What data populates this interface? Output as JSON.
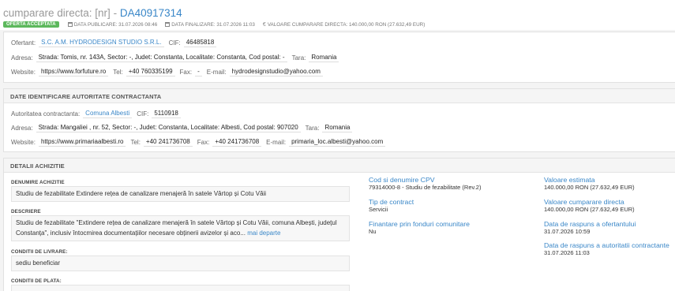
{
  "header": {
    "title_prefix": "cumparare directa: [nr]",
    "title_sep": "-",
    "title_code": "DA40917314",
    "badge": "OFERTA ACCEPTATA",
    "date_publicare": "DATA PUBLICARE: 31.07.2026 08:46",
    "date_finalizare": "DATA FINALIZARE: 31.07.2026 11:03",
    "valoare": "VALOARE CUMPARARE DIRECTA: 140.000,00 RON (27.632,49 EUR)"
  },
  "ofertant": {
    "label": "Ofertant:",
    "name": "S.C. A.M. HYDRODESIGN STUDIO S.R.L.",
    "cif_label": "CIF:",
    "cif": "46485818",
    "adresa_label": "Adresa:",
    "adresa": "Strada: Tomis, nr. 143A, Sector: -, Judet: Constanta, Localitate: Constanta, Cod postal: -",
    "tara_label": "Tara:",
    "tara": "Romania",
    "website_label": "Website:",
    "website": "https://www.forfuture.ro",
    "tel_label": "Tel:",
    "tel": "+40 760335199",
    "fax_label": "Fax:",
    "fax": "-",
    "email_label": "E-mail:",
    "email": "hydrodesignstudio@yahoo.com"
  },
  "autoritate": {
    "heading": "DATE IDENTIFICARE AUTORITATE CONTRACTANTA",
    "label": "Autoritatea contractanta:",
    "name": "Comuna Albesti",
    "cif_label": "CIF:",
    "cif": "5110918",
    "adresa_label": "Adresa:",
    "adresa": "Strada: Mangaliei , nr. 52, Sector: -, Judet: Constanta, Localitate: Albesti, Cod postal: 907020",
    "tara_label": "Tara:",
    "tara": "Romania",
    "website_label": "Website:",
    "website": "https://www.primariaalbesti.ro",
    "tel_label": "Tel:",
    "tel": "+40 241736708",
    "fax_label": "Fax:",
    "fax": "+40 241736708",
    "email_label": "E-mail:",
    "email": "primaria_loc.albesti@yahoo.com"
  },
  "detalii": {
    "heading": "DETALII ACHIZITIE",
    "denumire_label": "DENUMIRE ACHIZITIE",
    "denumire": "Studiu de fezabilitate Extindere rețea de canalizare menajeră în satele Vârtop și Cotu Văii",
    "descriere_label": "DESCRIERE",
    "descriere": "Studiu de fezabilitate \"Extindere rețea de canalizare menajeră în satele Vârtop și Cotu Văii, comuna Albești, județul Constanța\", inclusiv întocmirea documentațiilor necesare obținerii avizelor și aco...",
    "mai_departe": "mai departe",
    "conditii_livrare_label": "CONDITII DE LIVRARE:",
    "conditii_livrare": "sediu beneficiar",
    "conditii_plata_label": "CONDITII DE PLATA:",
    "cpv_label": "Cod si denumire CPV",
    "cpv": "79314000-8 - Studiu de fezabilitate (Rev.2)",
    "tip_label": "Tip de contract",
    "tip": "Servicii",
    "fonduri_label": "Finantare prin fonduri comunitare",
    "fonduri": "Nu",
    "val_estimata_label": "Valoare estimata",
    "val_estimata": "140.000,00  RON (27.632,49  EUR)",
    "val_cumparare_label": "Valoare cumparare directa",
    "val_cumparare": "140.000,00  RON (27.632,49  EUR)",
    "raspuns_ofertant_label": "Data de raspuns a ofertantului",
    "raspuns_ofertant": "31.07.2026 10:59",
    "raspuns_autoritate_label": "Data de raspuns a autoritatii contractante",
    "raspuns_autoritate": "31.07.2026 11:03"
  },
  "colors": {
    "accent": "#3a87c8",
    "badge": "#5cb85c"
  }
}
